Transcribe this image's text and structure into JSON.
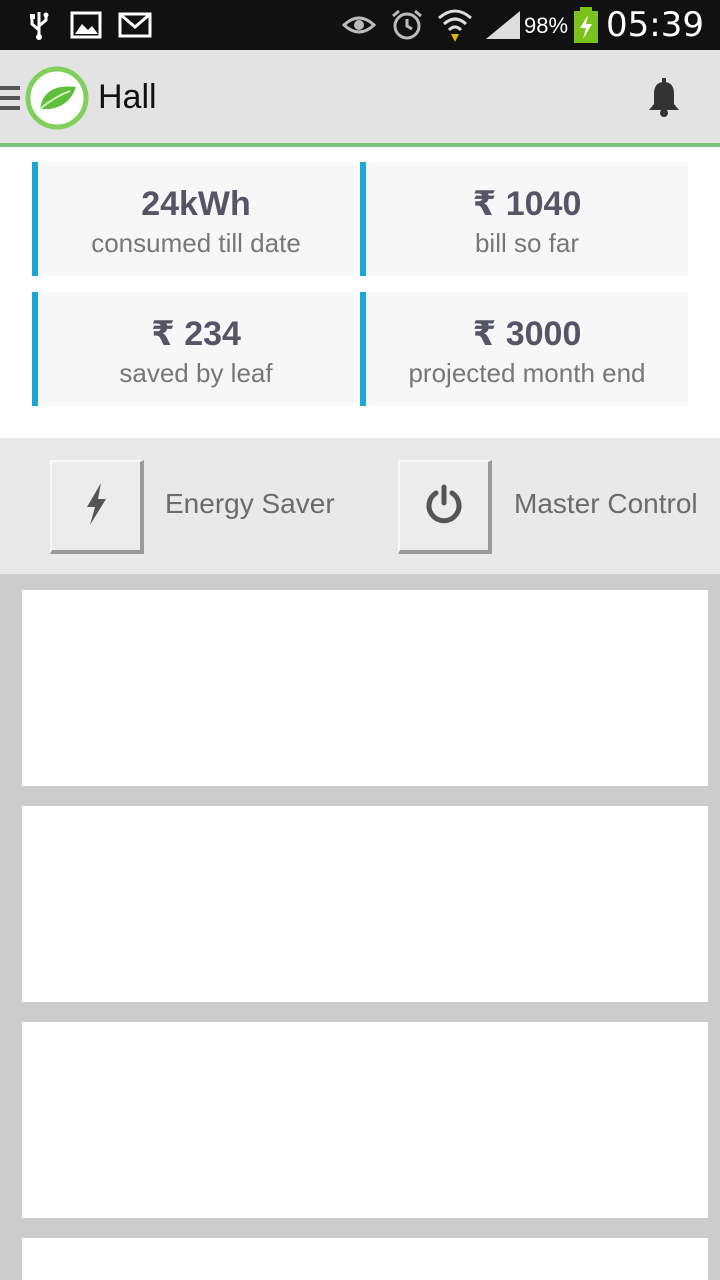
{
  "status_bar": {
    "icons": [
      "usb-icon",
      "image-icon",
      "gmail-icon",
      "eye-icon",
      "alarm-icon",
      "wifi-icon",
      "signal-icon",
      "battery-charging-icon"
    ],
    "battery": "98%",
    "time": "05:39"
  },
  "app_bar": {
    "title": "Hall",
    "menu_icon": "menu-icon",
    "logo": "leaf-logo",
    "notification_icon": "bell-icon"
  },
  "stats": [
    {
      "value": "24kWh",
      "label": "consumed till date",
      "currency": ""
    },
    {
      "value": "1040",
      "label": "bill so far",
      "currency": "₹"
    },
    {
      "value": "234",
      "label": "saved by leaf",
      "currency": "₹"
    },
    {
      "value": "3000",
      "label": "projected month end",
      "currency": "₹"
    }
  ],
  "controls": [
    {
      "label": "Energy Saver",
      "icon": "lightning-icon"
    },
    {
      "label": "Master Control",
      "icon": "power-icon"
    }
  ],
  "colors": {
    "accent_blue": "#1aa6d6",
    "accent_green": "#7dc47f",
    "stat_text": "#555566",
    "app_bar_bg": "#e3e3e3"
  }
}
